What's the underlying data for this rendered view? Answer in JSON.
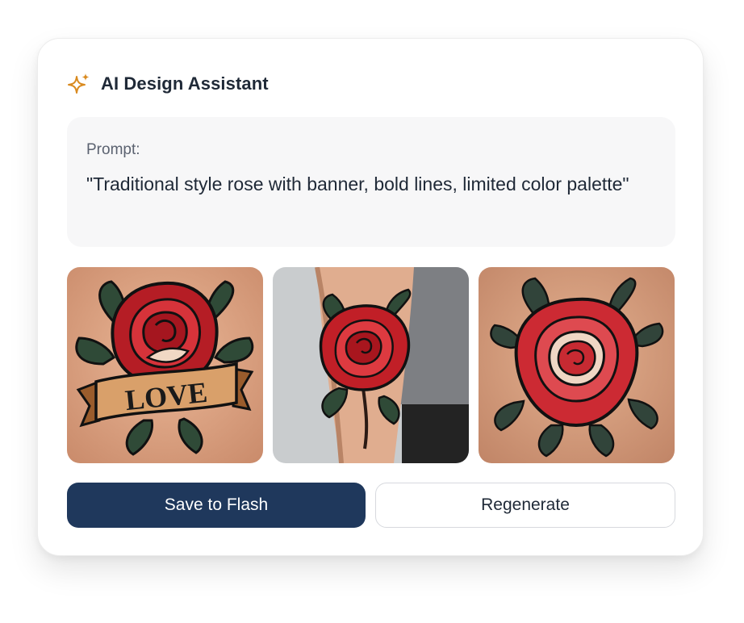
{
  "header": {
    "title": "AI Design Assistant",
    "icon": "sparkle-icon"
  },
  "prompt": {
    "label": "Prompt:",
    "text": "\"Traditional style rose with banner, bold lines, limited color palette\""
  },
  "gallery": {
    "images": [
      {
        "name": "rose-tattoo-love-banner",
        "banner_text": "LOVE"
      },
      {
        "name": "rose-tattoo-forearm"
      },
      {
        "name": "rose-tattoo-traditional"
      }
    ]
  },
  "actions": {
    "save_label": "Save to Flash",
    "regenerate_label": "Regenerate"
  },
  "colors": {
    "primary": "#1f385c",
    "accent": "#d98a1f",
    "rose": "#c8202a",
    "leaf": "#2f4a37"
  }
}
